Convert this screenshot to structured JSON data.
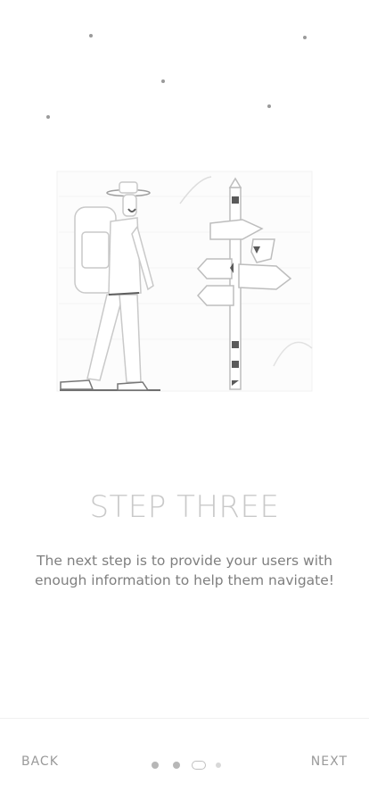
{
  "onboarding": {
    "title": "STEP THREE",
    "description_line1": "The next step is to provide your users with",
    "description_line2": "enough information to help them navigate!"
  },
  "footer": {
    "back_label": "BACK",
    "next_label": "NEXT",
    "pagination": {
      "total": 4,
      "active_index": 2
    }
  },
  "illustration": {
    "name": "hiker-signpost-illustration"
  },
  "colors": {
    "background": "#ffffff",
    "title": "#c9c9c9",
    "text": "#7f7f7f",
    "nav": "#9a9a9a"
  }
}
